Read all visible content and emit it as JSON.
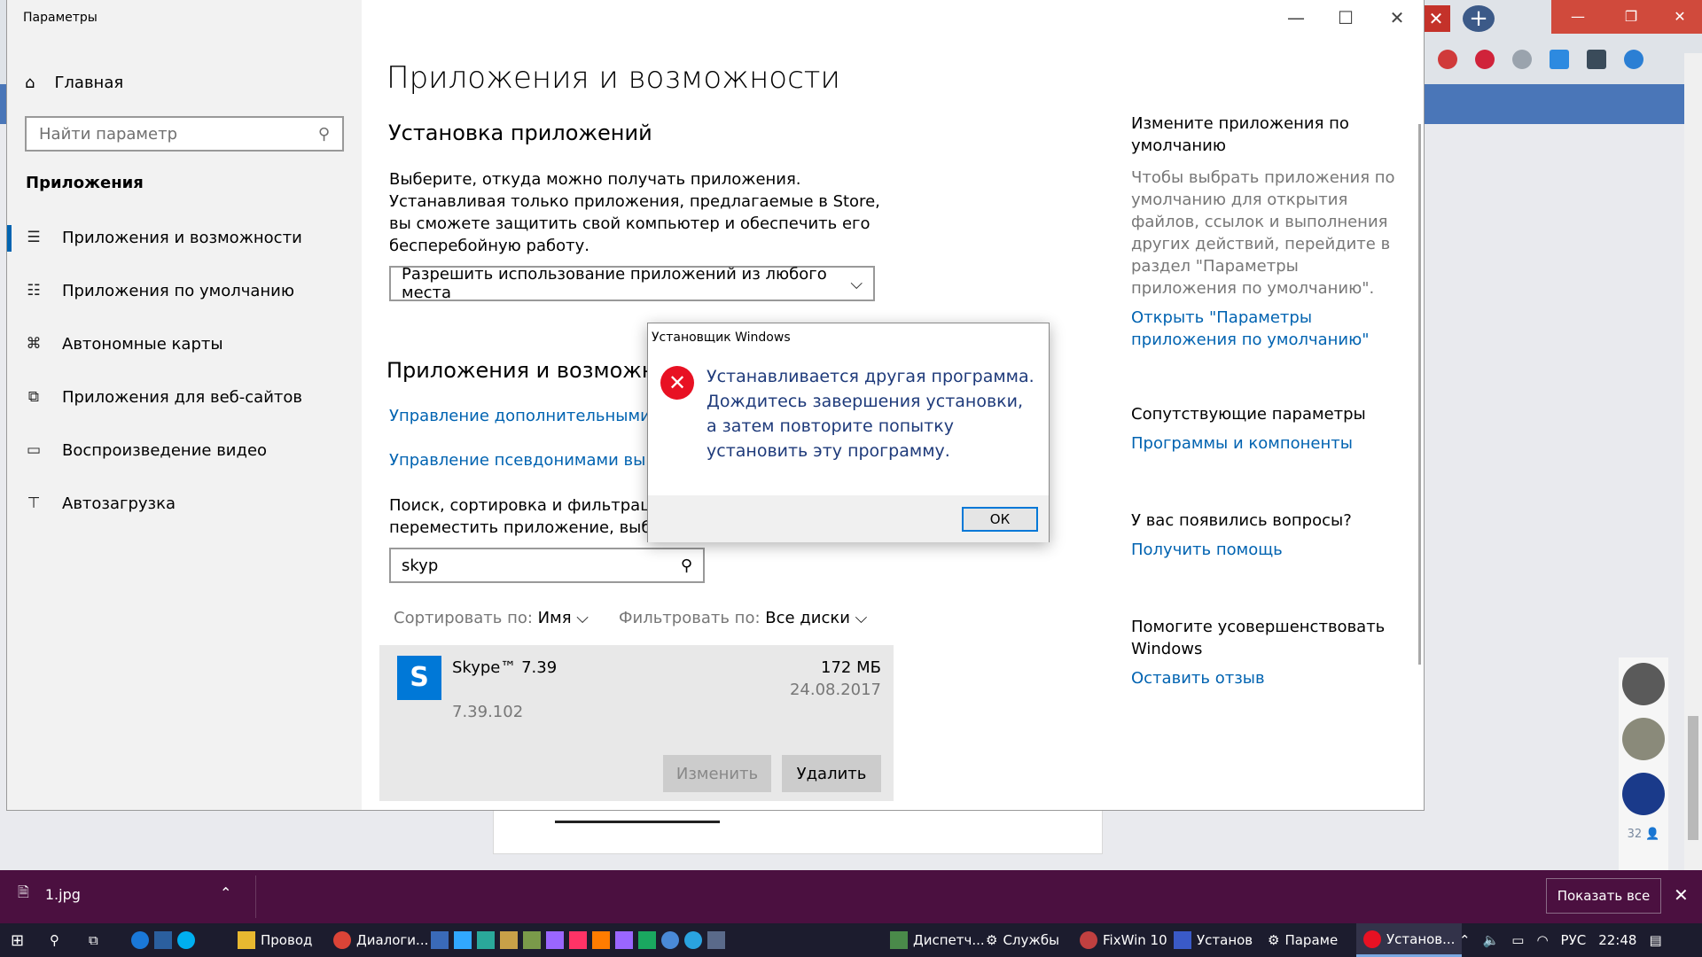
{
  "browser": {
    "close_tab_glyph": "✕",
    "new_tab_glyph": "+",
    "avatar_count": "32"
  },
  "settings": {
    "window_title": "Параметры",
    "home_label": "Главная",
    "search_placeholder": "Найти параметр",
    "group_label": "Приложения",
    "nav": [
      {
        "label": "Приложения и возможности",
        "icon": "list-icon"
      },
      {
        "label": "Приложения по умолчанию",
        "icon": "default-apps-icon"
      },
      {
        "label": "Автономные карты",
        "icon": "map-icon"
      },
      {
        "label": "Приложения для веб-сайтов",
        "icon": "web-app-icon"
      },
      {
        "label": "Воспроизведение видео",
        "icon": "video-icon"
      },
      {
        "label": "Автозагрузка",
        "icon": "startup-icon"
      }
    ],
    "page_title": "Приложения и возможности",
    "install_heading": "Установка приложений",
    "install_desc": "Выберите, откуда можно получать приложения. Устанавливая только приложения, предлагаемые в Store, вы сможете защитить свой компьютер и обеспечить его бесперебойную работу.",
    "install_dropdown_value": "Разрешить использование приложений из любого места",
    "apps_heading": "Приложения и возможности",
    "link_optional": "Управление дополнительными компонентами",
    "link_aliases": "Управление псевдонимами выполнения приложений",
    "filter_desc_1": "Поиск, сортировка и фильтрация по дискам. Если вы хотите удалить или",
    "filter_desc_2": "переместить приложение, выберите его в списке.",
    "app_search_value": "skyp",
    "sort_label": "Сортировать по:",
    "sort_value": "Имя",
    "filter_label": "Фильтровать по:",
    "filter_value": "Все диски",
    "app": {
      "name": "Skype™ 7.39",
      "size": "172 МБ",
      "date": "24.08.2017",
      "version": "7.39.102",
      "change_label": "Изменить",
      "remove_label": "Удалить"
    },
    "right": {
      "default_heading": "Измените приложения по умолчанию",
      "default_desc": "Чтобы выбрать приложения по умолчанию для открытия файлов, ссылок и выполнения других действий, перейдите в раздел \"Параметры приложения по умолчанию\".",
      "default_link": "Открыть \"Параметры приложения по умолчанию\"",
      "related_heading": "Сопутствующие параметры",
      "related_link": "Программы и компоненты",
      "questions_heading": "У вас появились вопросы?",
      "questions_link": "Получить помощь",
      "improve_heading": "Помогите усовершенствовать Windows",
      "improve_link": "Оставить отзыв"
    }
  },
  "dialog": {
    "title": "Установщик Windows",
    "message": "Устанавливается другая программа. Дождитесь завершения установки, а затем повторите попытку установить эту программу.",
    "ok_label": "ОК"
  },
  "downloads": {
    "file_name": "1.jpg",
    "show_all_label": "Показать все"
  },
  "taskbar": {
    "items": [
      "Провод",
      "Диалоги...",
      "Диспетч...",
      "Службы",
      "FixWin 10",
      "Установ",
      "Параме",
      "Установ..."
    ],
    "lang": "РУС",
    "time": "22:48"
  },
  "colors": {
    "accent": "#0063b1",
    "error": "#e81123",
    "downloads_bar": "#4b1040",
    "taskbar": "#1c1c2e"
  }
}
